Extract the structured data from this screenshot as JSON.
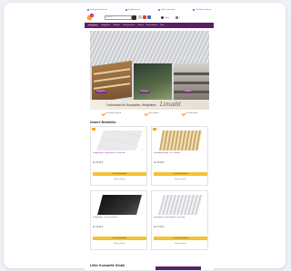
{
  "topbar": {
    "items": [
      "Kostenloser Versand",
      "Kundenservice",
      "Sicher einkaufen",
      "Schnelle Lieferung"
    ]
  },
  "header": {
    "search_placeholder": "Suchen...",
    "account_label": "Konto",
    "cart_count": "0"
  },
  "nav": {
    "items": [
      "Lichtplatten",
      "Stegplatten",
      "Zubehör",
      "Terrassendach",
      "Carport",
      "Gewächshaus",
      "Sale"
    ]
  },
  "hero": {
    "label_left": "Stegplatten",
    "label_mid": "Wellplatten",
    "label_right": "Zubehör",
    "banner_text": "Fachhandel für Bauplatten, Wellplatten",
    "banner_brand": "Limadd"
  },
  "usp": {
    "items": [
      "Schneller Versand",
      "Top Qualität",
      "Fachberatung"
    ]
  },
  "bestseller": {
    "title": "Unsere Bestseller",
    "products": [
      {
        "name": "Stegplatten Polycarbonat 16 mm klar",
        "price": "ab 29,90 €",
        "cart": "In den Warenkorb",
        "more": "Mehr erfahren"
      },
      {
        "name": "Wellplatten Acryl 76/18 bronze",
        "price": "ab 19,90 €",
        "cart": "In den Warenkorb",
        "more": "Mehr erfahren"
      },
      {
        "name": "Stegplatten 16 mm anthrazit",
        "price": "ab 34,90 €",
        "cart": "In den Warenkorb",
        "more": "Mehr erfahren"
      },
      {
        "name": "Wellplatten Polycarbonat 76/18 klar",
        "price": "ab 17,90 €",
        "cart": "In den Warenkorb",
        "more": "Mehr erfahren"
      }
    ]
  },
  "promo": {
    "title": "Lifter Kunstoffe Gmbh"
  },
  "colors": {
    "brand_purple": "#5c1f63",
    "accent_orange": "#f6a21e",
    "cart_yellow": "#f5c231"
  }
}
